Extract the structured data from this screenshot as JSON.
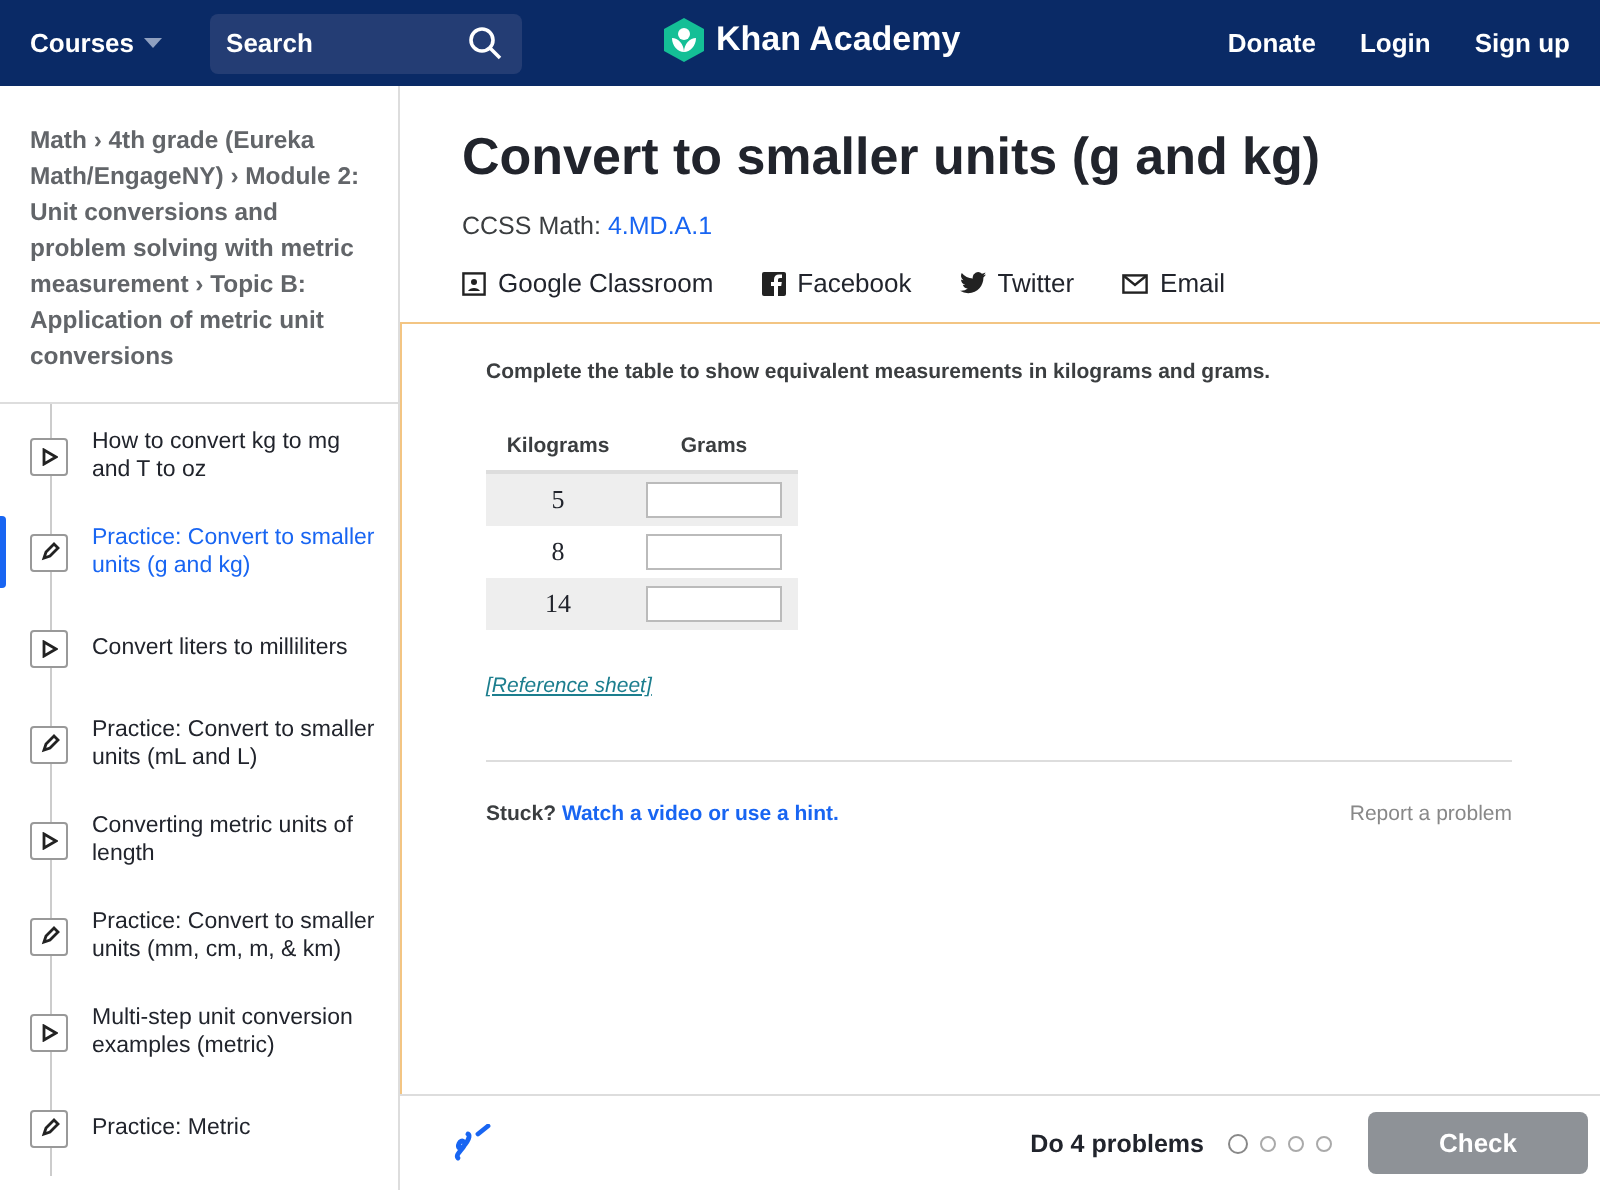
{
  "header": {
    "courses": "Courses",
    "search": {
      "placeholder": "Search"
    },
    "logo": "Khan Academy",
    "links": [
      "Donate",
      "Login",
      "Sign up"
    ]
  },
  "breadcrumb": "Math › 4th grade (Eureka Math/EngageNY) › Module 2: Unit conversions and problem solving with metric measurement › Topic B: Application of metric unit conversions",
  "sidebar": {
    "items": [
      {
        "kind": "video",
        "label": "How to convert kg to mg and T to oz",
        "selected": false
      },
      {
        "kind": "exercise",
        "label": "Practice: Convert to smaller units (g and kg)",
        "selected": true
      },
      {
        "kind": "video",
        "label": "Convert liters to milliliters",
        "selected": false
      },
      {
        "kind": "exercise",
        "label": "Practice: Convert to smaller units (mL and L)",
        "selected": false
      },
      {
        "kind": "video",
        "label": "Converting metric units of length",
        "selected": false
      },
      {
        "kind": "exercise",
        "label": "Practice: Convert to smaller units (mm, cm, m, & km)",
        "selected": false
      },
      {
        "kind": "video",
        "label": "Multi-step unit conversion examples (metric)",
        "selected": false
      },
      {
        "kind": "exercise",
        "label": "Practice: Metric",
        "selected": false
      }
    ]
  },
  "title": "Convert to smaller units (g and kg)",
  "standard": {
    "label": "CCSS Math:",
    "code": "4.MD.A.1"
  },
  "share": [
    {
      "kind": "classroom",
      "label": "Google Classroom"
    },
    {
      "kind": "facebook",
      "label": "Facebook"
    },
    {
      "kind": "twitter",
      "label": "Twitter"
    },
    {
      "kind": "email",
      "label": "Email"
    }
  ],
  "exercise": {
    "prompt": "Complete the table to show equivalent measurements in kilograms and grams.",
    "table": {
      "columns": [
        "Kilograms",
        "Grams"
      ],
      "rows": [
        {
          "kilograms": "5"
        },
        {
          "kilograms": "8"
        },
        {
          "kilograms": "14"
        }
      ]
    },
    "reference": "[Reference sheet]",
    "stuck": "Stuck?",
    "hint": "Watch a video or use a hint.",
    "report": "Report a problem"
  },
  "footer": {
    "task": "Do 4 problems",
    "dots": [
      {
        "selected": true
      },
      {
        "selected": false
      },
      {
        "selected": false
      },
      {
        "selected": false
      }
    ],
    "check": {
      "label": "Check",
      "disabled": true
    }
  }
}
